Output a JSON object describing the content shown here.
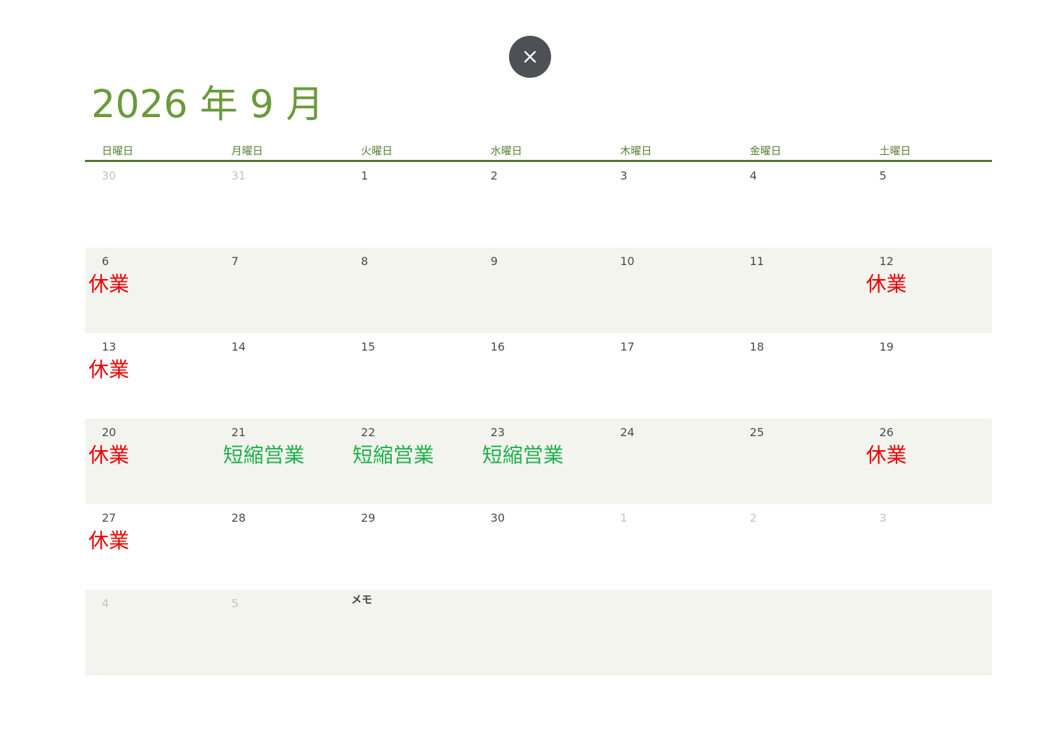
{
  "close_button": {
    "icon": "close-icon"
  },
  "calendar": {
    "title": "2026 年 9 月",
    "weekdays": [
      "日曜日",
      "月曜日",
      "火曜日",
      "水曜日",
      "木曜日",
      "金曜日",
      "土曜日"
    ],
    "memo_label": "メモ",
    "colors": {
      "title": "#6a9a3a",
      "header_line": "#4f7a2b",
      "closed": "#ee0000",
      "short_hours": "#1db04a",
      "shaded_row": "#f4f4ef",
      "close_button": "#4d5156"
    },
    "weeks": [
      [
        {
          "day": "30",
          "other": true
        },
        {
          "day": "31",
          "other": true
        },
        {
          "day": "1"
        },
        {
          "day": "2"
        },
        {
          "day": "3"
        },
        {
          "day": "4"
        },
        {
          "day": "5"
        }
      ],
      [
        {
          "day": "6",
          "label": "休業",
          "kind": "closed"
        },
        {
          "day": "7"
        },
        {
          "day": "8"
        },
        {
          "day": "9"
        },
        {
          "day": "10"
        },
        {
          "day": "11"
        },
        {
          "day": "12",
          "label": "休業",
          "kind": "closed"
        }
      ],
      [
        {
          "day": "13",
          "label": "休業",
          "kind": "closed"
        },
        {
          "day": "14"
        },
        {
          "day": "15"
        },
        {
          "day": "16"
        },
        {
          "day": "17"
        },
        {
          "day": "18"
        },
        {
          "day": "19"
        }
      ],
      [
        {
          "day": "20",
          "label": "休業",
          "kind": "closed"
        },
        {
          "day": "21",
          "label": "短縮営業",
          "kind": "short"
        },
        {
          "day": "22",
          "label": "短縮営業",
          "kind": "short"
        },
        {
          "day": "23",
          "label": "短縮営業",
          "kind": "short"
        },
        {
          "day": "24"
        },
        {
          "day": "25"
        },
        {
          "day": "26",
          "label": "休業",
          "kind": "closed"
        }
      ],
      [
        {
          "day": "27",
          "label": "休業",
          "kind": "closed"
        },
        {
          "day": "28"
        },
        {
          "day": "29"
        },
        {
          "day": "30"
        },
        {
          "day": "1",
          "other": true
        },
        {
          "day": "2",
          "other": true
        },
        {
          "day": "3",
          "other": true
        }
      ],
      [
        {
          "day": "4",
          "other": true
        },
        {
          "day": "5",
          "other": true
        },
        {
          "memo": true
        },
        {},
        {},
        {},
        {}
      ]
    ]
  }
}
